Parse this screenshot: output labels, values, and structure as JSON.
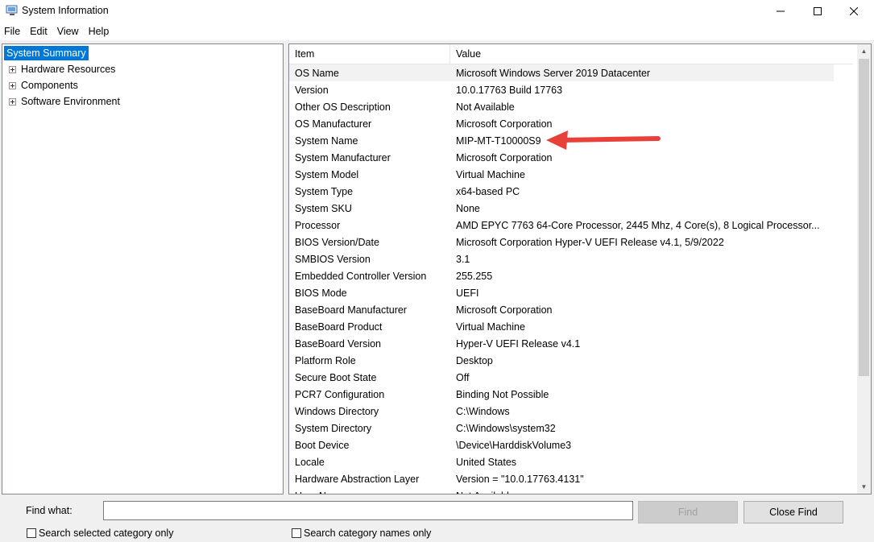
{
  "window": {
    "title": "System Information",
    "icon": "system-information-icon"
  },
  "menu": [
    "File",
    "Edit",
    "View",
    "Help"
  ],
  "tree": {
    "selected": "System Summary",
    "children": [
      "Hardware Resources",
      "Components",
      "Software Environment"
    ]
  },
  "list": {
    "columns": {
      "item": "Item",
      "value": "Value"
    },
    "rows": [
      {
        "item": "OS Name",
        "value": "Microsoft Windows Server 2019 Datacenter"
      },
      {
        "item": "Version",
        "value": "10.0.17763 Build 17763"
      },
      {
        "item": "Other OS Description",
        "value": "Not Available"
      },
      {
        "item": "OS Manufacturer",
        "value": "Microsoft Corporation"
      },
      {
        "item": "System Name",
        "value": "MIP-MT-T10000S9"
      },
      {
        "item": "System Manufacturer",
        "value": "Microsoft Corporation"
      },
      {
        "item": "System Model",
        "value": "Virtual Machine"
      },
      {
        "item": "System Type",
        "value": "x64-based PC"
      },
      {
        "item": "System SKU",
        "value": "None"
      },
      {
        "item": "Processor",
        "value": "AMD EPYC 7763 64-Core Processor, 2445 Mhz, 4 Core(s), 8 Logical Processor..."
      },
      {
        "item": "BIOS Version/Date",
        "value": "Microsoft Corporation Hyper-V UEFI Release v4.1, 5/9/2022"
      },
      {
        "item": "SMBIOS Version",
        "value": "3.1"
      },
      {
        "item": "Embedded Controller Version",
        "value": "255.255"
      },
      {
        "item": "BIOS Mode",
        "value": "UEFI"
      },
      {
        "item": "BaseBoard Manufacturer",
        "value": "Microsoft Corporation"
      },
      {
        "item": "BaseBoard Product",
        "value": "Virtual Machine"
      },
      {
        "item": "BaseBoard Version",
        "value": "Hyper-V UEFI Release v4.1"
      },
      {
        "item": "Platform Role",
        "value": "Desktop"
      },
      {
        "item": "Secure Boot State",
        "value": "Off"
      },
      {
        "item": "PCR7 Configuration",
        "value": "Binding Not Possible"
      },
      {
        "item": "Windows Directory",
        "value": "C:\\Windows"
      },
      {
        "item": "System Directory",
        "value": "C:\\Windows\\system32"
      },
      {
        "item": "Boot Device",
        "value": "\\Device\\HarddiskVolume3"
      },
      {
        "item": "Locale",
        "value": "United States"
      },
      {
        "item": "Hardware Abstraction Layer",
        "value": "Version = \"10.0.17763.4131\""
      },
      {
        "item": "User Name",
        "value": "Not Available"
      }
    ]
  },
  "annotation": {
    "arrow_color": "#e8413a",
    "points_to": "System Name"
  },
  "find": {
    "label": "Find what:",
    "value": "",
    "find_button": "Find",
    "close_button": "Close Find",
    "check_selected": "Search selected category only",
    "check_names": "Search category names only"
  },
  "colors": {
    "selection": "#0078d7",
    "window_bg": "#f0f0f0"
  }
}
